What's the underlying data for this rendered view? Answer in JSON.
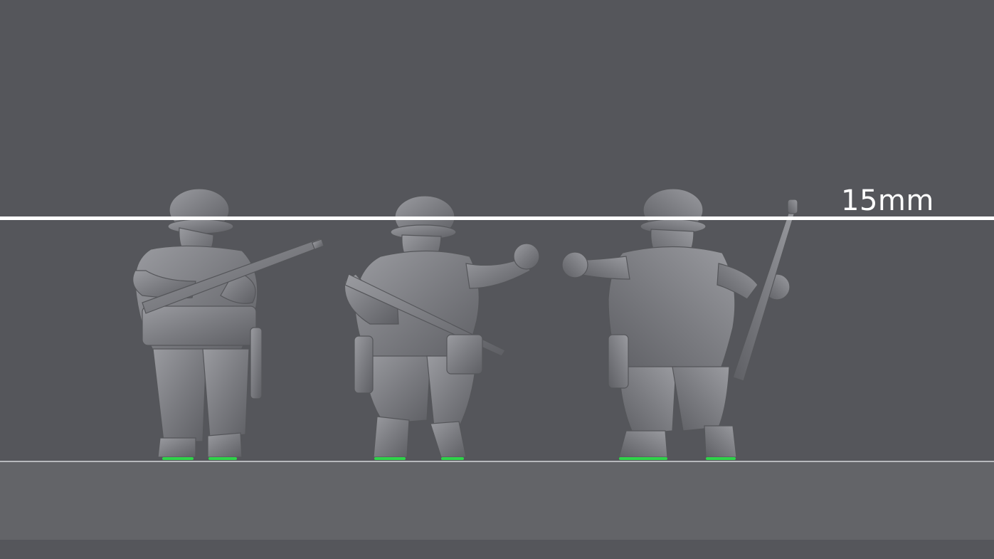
{
  "scale": {
    "label": "15mm"
  },
  "figures": [
    {
      "name": "soldier-aiming-rifle"
    },
    {
      "name": "soldier-shouting-pointing"
    },
    {
      "name": "soldier-shouting-holding-rifle"
    }
  ],
  "colors": {
    "background": "#55565b",
    "floor": "#636468",
    "miniature": "#7a7b80",
    "scale_line": "#ffffff",
    "base_highlight": "#2fd44a"
  }
}
